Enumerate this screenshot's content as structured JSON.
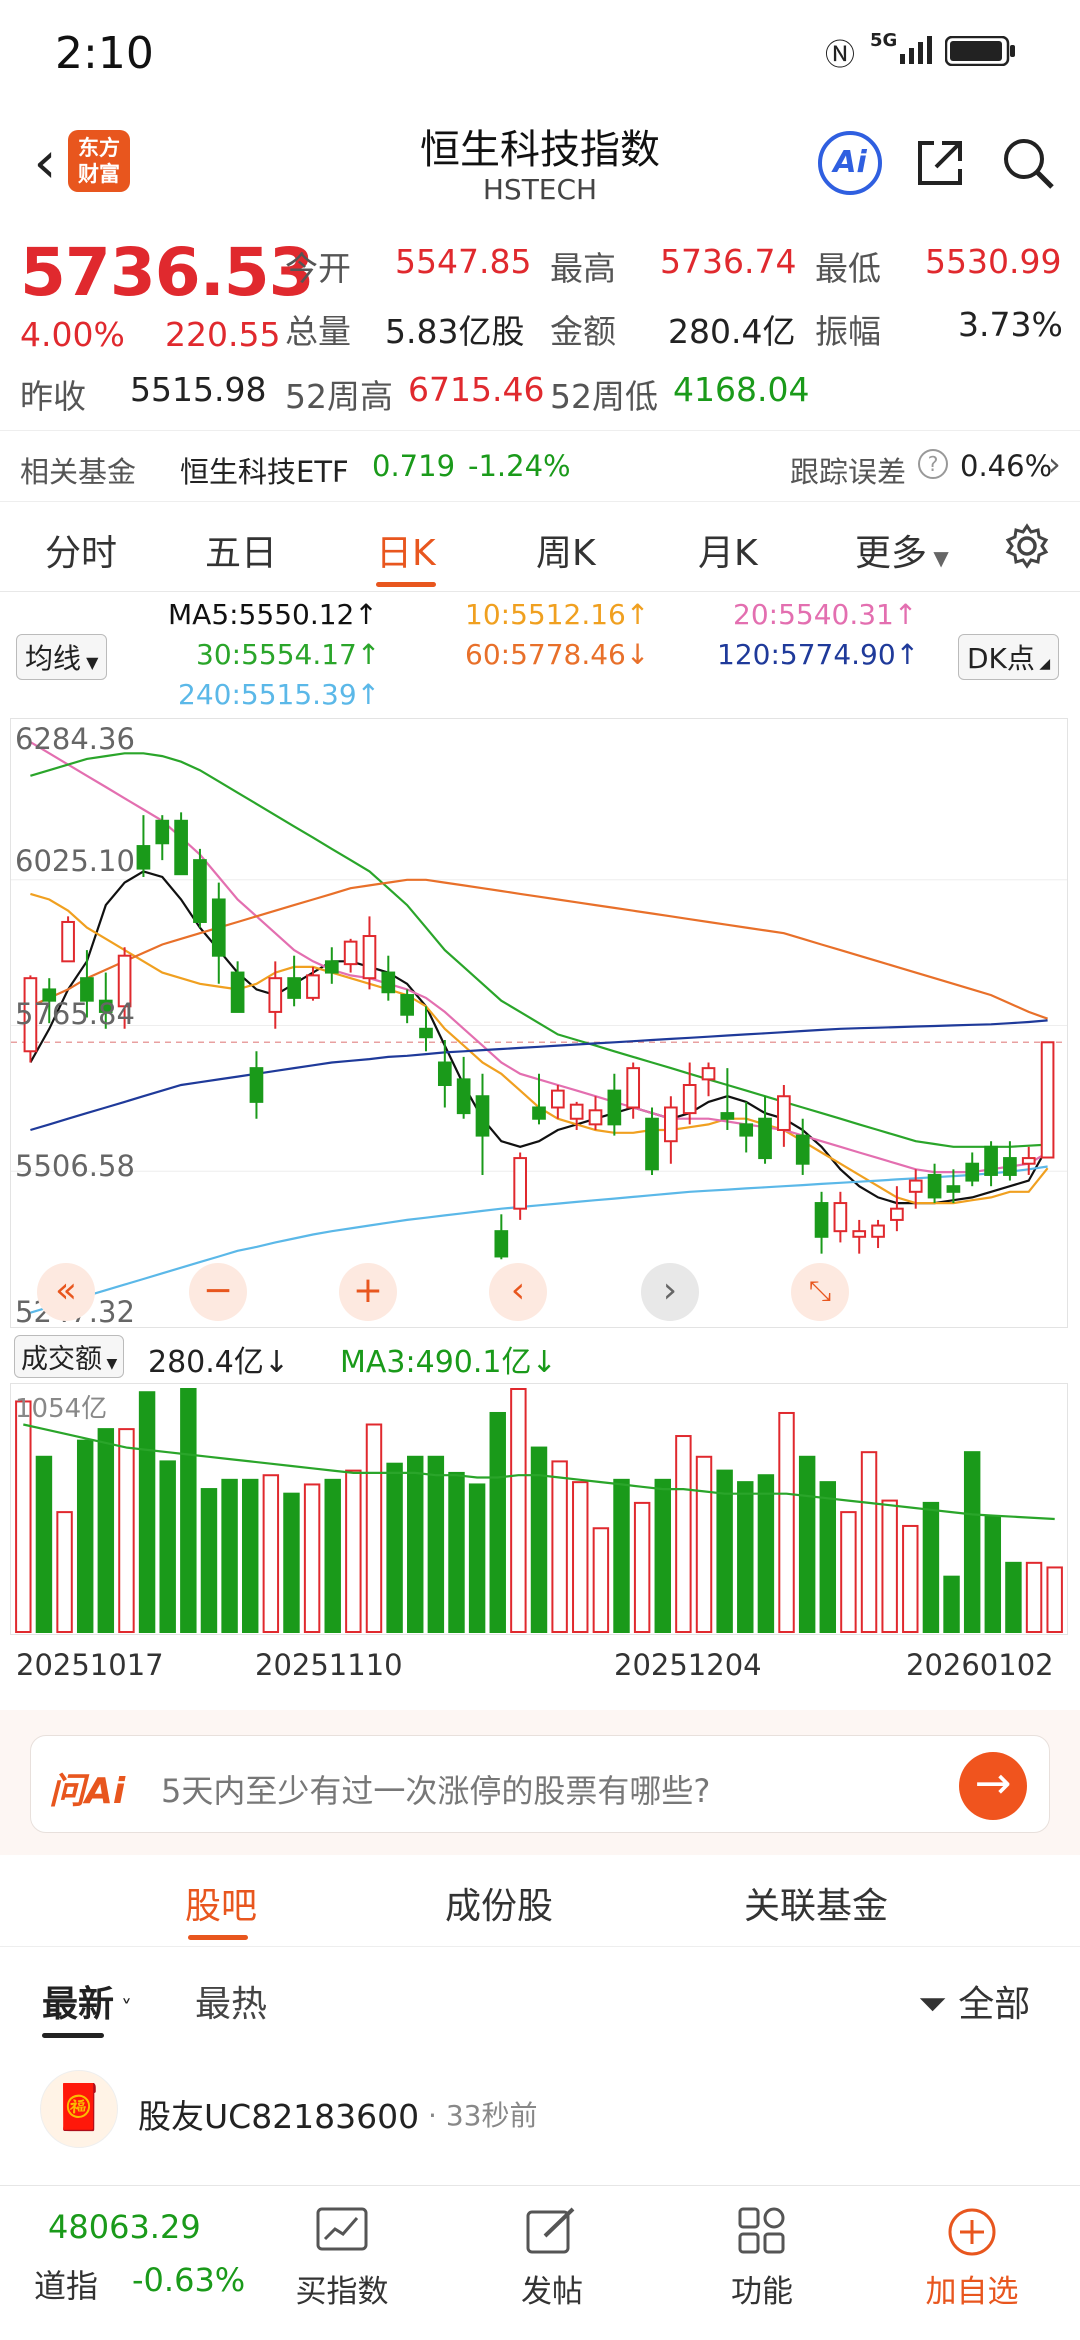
{
  "status_bar": {
    "time": "2:10",
    "network": "5G",
    "icons": [
      "nfc-icon",
      "signal-icon",
      "battery-icon"
    ]
  },
  "header": {
    "logo_text": "东方财富",
    "title": "恒生科技指数",
    "subtitle": "HSTECH",
    "ai_label": "Ai"
  },
  "quote": {
    "price": "5736.53",
    "change_pct": "4.00%",
    "change": "220.55",
    "open_label": "今开",
    "open": "5547.85",
    "high_label": "最高",
    "high": "5736.74",
    "low_label": "最低",
    "low": "5530.99",
    "volume_label": "总量",
    "volume": "5.83亿股",
    "amount_label": "金额",
    "amount": "280.4亿",
    "amplitude_label": "振幅",
    "amplitude": "3.73%",
    "prev_close_label": "昨收",
    "prev_close": "5515.98",
    "w52_high_label": "52周高",
    "w52_high": "6715.46",
    "w52_low_label": "52周低",
    "w52_low": "4168.04"
  },
  "related_fund": {
    "label": "相关基金",
    "name": "恒生科技ETF",
    "price": "0.719",
    "change": "-1.24%",
    "tracking_label": "跟踪误差",
    "tracking_value": "0.46%"
  },
  "chart_tabs": [
    "分时",
    "五日",
    "日K",
    "周K",
    "月K",
    "更多"
  ],
  "active_chart_tab": "日K",
  "ma_selector": "均线",
  "dk_button": "DK点",
  "ma_legend": {
    "ma5": "MA5:5550.12↑",
    "ma10": "10:5512.16↑",
    "ma20": "20:5540.31↑",
    "ma30": "30:5554.17↑",
    "ma60": "60:5778.46↓",
    "ma120": "120:5774.90↑",
    "ma240": "240:5515.39↑"
  },
  "colors": {
    "up": "#e0292e",
    "down": "#1a9a1a",
    "accent": "#e8561e",
    "ma5": "#111111",
    "ma10": "#f0a020",
    "ma20": "#e36fb0",
    "ma30": "#2aa52a",
    "ma60": "#e8702a",
    "ma120": "#1f3a9a",
    "ma240": "#5bb8e8"
  },
  "chart_data": {
    "type": "candlestick",
    "ylim": [
      5247.32,
      6284.36
    ],
    "y_ticks": [
      "6284.36",
      "6025.10",
      "5765.84",
      "5506.58",
      "5247.32"
    ],
    "x_ticks": [
      "20251017",
      "20251110",
      "20251204",
      "20260102"
    ],
    "candles": [
      {
        "o": 5720,
        "h": 5855,
        "l": 5700,
        "c": 5850
      },
      {
        "o": 5830,
        "h": 5850,
        "l": 5770,
        "c": 5810
      },
      {
        "o": 5880,
        "h": 5960,
        "l": 5880,
        "c": 5950
      },
      {
        "o": 5850,
        "h": 5900,
        "l": 5780,
        "c": 5810
      },
      {
        "o": 5810,
        "h": 5860,
        "l": 5760,
        "c": 5790
      },
      {
        "o": 5800,
        "h": 5905,
        "l": 5760,
        "c": 5890
      },
      {
        "o": 6085,
        "h": 6140,
        "l": 6030,
        "c": 6045
      },
      {
        "o": 6130,
        "h": 6140,
        "l": 6060,
        "c": 6090
      },
      {
        "o": 6130,
        "h": 6145,
        "l": 6035,
        "c": 6035
      },
      {
        "o": 6060,
        "h": 6080,
        "l": 5940,
        "c": 5950
      },
      {
        "o": 5990,
        "h": 6020,
        "l": 5840,
        "c": 5890
      },
      {
        "o": 5860,
        "h": 5880,
        "l": 5790,
        "c": 5790
      },
      {
        "o": 5690,
        "h": 5720,
        "l": 5600,
        "c": 5630
      },
      {
        "o": 5790,
        "h": 5880,
        "l": 5760,
        "c": 5850
      },
      {
        "o": 5850,
        "h": 5890,
        "l": 5800,
        "c": 5815
      },
      {
        "o": 5815,
        "h": 5870,
        "l": 5810,
        "c": 5855
      },
      {
        "o": 5880,
        "h": 5905,
        "l": 5840,
        "c": 5860
      },
      {
        "o": 5875,
        "h": 5920,
        "l": 5860,
        "c": 5915
      },
      {
        "o": 5850,
        "h": 5960,
        "l": 5830,
        "c": 5925
      },
      {
        "o": 5860,
        "h": 5890,
        "l": 5810,
        "c": 5825
      },
      {
        "o": 5820,
        "h": 5830,
        "l": 5770,
        "c": 5785
      },
      {
        "o": 5760,
        "h": 5800,
        "l": 5720,
        "c": 5745
      },
      {
        "o": 5700,
        "h": 5740,
        "l": 5620,
        "c": 5660
      },
      {
        "o": 5670,
        "h": 5710,
        "l": 5600,
        "c": 5610
      },
      {
        "o": 5640,
        "h": 5680,
        "l": 5500,
        "c": 5570
      },
      {
        "o": 5400,
        "h": 5430,
        "l": 5350,
        "c": 5355
      },
      {
        "o": 5440,
        "h": 5540,
        "l": 5420,
        "c": 5530
      },
      {
        "o": 5620,
        "h": 5680,
        "l": 5590,
        "c": 5600
      },
      {
        "o": 5620,
        "h": 5660,
        "l": 5600,
        "c": 5650
      },
      {
        "o": 5600,
        "h": 5630,
        "l": 5580,
        "c": 5625
      },
      {
        "o": 5590,
        "h": 5640,
        "l": 5580,
        "c": 5615
      },
      {
        "o": 5650,
        "h": 5680,
        "l": 5570,
        "c": 5590
      },
      {
        "o": 5620,
        "h": 5700,
        "l": 5600,
        "c": 5690
      },
      {
        "o": 5600,
        "h": 5620,
        "l": 5500,
        "c": 5510
      },
      {
        "o": 5560,
        "h": 5640,
        "l": 5520,
        "c": 5620
      },
      {
        "o": 5610,
        "h": 5700,
        "l": 5590,
        "c": 5660
      },
      {
        "o": 5670,
        "h": 5700,
        "l": 5640,
        "c": 5690
      },
      {
        "o": 5610,
        "h": 5690,
        "l": 5580,
        "c": 5600
      },
      {
        "o": 5590,
        "h": 5630,
        "l": 5540,
        "c": 5570
      },
      {
        "o": 5600,
        "h": 5640,
        "l": 5520,
        "c": 5530
      },
      {
        "o": 5580,
        "h": 5660,
        "l": 5550,
        "c": 5640
      },
      {
        "o": 5570,
        "h": 5600,
        "l": 5500,
        "c": 5520
      },
      {
        "o": 5450,
        "h": 5470,
        "l": 5360,
        "c": 5390
      },
      {
        "o": 5400,
        "h": 5470,
        "l": 5380,
        "c": 5450
      },
      {
        "o": 5390,
        "h": 5420,
        "l": 5360,
        "c": 5400
      },
      {
        "o": 5390,
        "h": 5420,
        "l": 5370,
        "c": 5410
      },
      {
        "o": 5420,
        "h": 5480,
        "l": 5400,
        "c": 5440
      },
      {
        "o": 5470,
        "h": 5510,
        "l": 5440,
        "c": 5490
      },
      {
        "o": 5500,
        "h": 5520,
        "l": 5450,
        "c": 5460
      },
      {
        "o": 5480,
        "h": 5510,
        "l": 5450,
        "c": 5470
      },
      {
        "o": 5520,
        "h": 5540,
        "l": 5480,
        "c": 5490
      },
      {
        "o": 5550,
        "h": 5560,
        "l": 5480,
        "c": 5500
      },
      {
        "o": 5530,
        "h": 5560,
        "l": 5490,
        "c": 5500
      },
      {
        "o": 5520,
        "h": 5550,
        "l": 5500,
        "c": 5530
      },
      {
        "o": 5531,
        "h": 5737,
        "l": 5531,
        "c": 5736
      }
    ],
    "ma_lines": {
      "ma5": [
        5700,
        5760,
        5830,
        5880,
        5980,
        6020,
        6040,
        6030,
        5990,
        5940,
        5900,
        5860,
        5830,
        5820,
        5840,
        5860,
        5880,
        5880,
        5870,
        5860,
        5840,
        5800,
        5730,
        5660,
        5600,
        5560,
        5550,
        5560,
        5580,
        5590,
        5600,
        5610,
        5620,
        5610,
        5600,
        5610,
        5630,
        5640,
        5630,
        5610,
        5600,
        5580,
        5550,
        5510,
        5480,
        5460,
        5450,
        5450,
        5450,
        5455,
        5460,
        5470,
        5480,
        5490,
        5550
      ],
      "ma10": [
        6000,
        5990,
        5970,
        5940,
        5920,
        5900,
        5880,
        5860,
        5850,
        5840,
        5835,
        5830,
        5840,
        5860,
        5870,
        5870,
        5860,
        5850,
        5840,
        5830,
        5820,
        5800,
        5760,
        5730,
        5700,
        5680,
        5650,
        5620,
        5600,
        5590,
        5580,
        5575,
        5575,
        5580,
        5580,
        5585,
        5590,
        5600,
        5600,
        5590,
        5580,
        5560,
        5540,
        5520,
        5500,
        5480,
        5460,
        5450,
        5450,
        5450,
        5455,
        5460,
        5470,
        5470,
        5512
      ],
      "ma20": [
        6270,
        6250,
        6230,
        6210,
        6190,
        6170,
        6150,
        6130,
        6100,
        6070,
        6030,
        5990,
        5960,
        5930,
        5900,
        5880,
        5865,
        5855,
        5850,
        5840,
        5830,
        5815,
        5790,
        5760,
        5730,
        5700,
        5680,
        5670,
        5660,
        5650,
        5640,
        5630,
        5620,
        5610,
        5600,
        5600,
        5600,
        5595,
        5590,
        5585,
        5580,
        5570,
        5560,
        5550,
        5540,
        5530,
        5520,
        5510,
        5505,
        5505,
        5505,
        5510,
        5515,
        5520,
        5540
      ],
      "ma30": [
        6210,
        6220,
        6230,
        6240,
        6245,
        6250,
        6250,
        6245,
        6235,
        6220,
        6200,
        6180,
        6160,
        6140,
        6120,
        6100,
        6080,
        6060,
        6040,
        6010,
        5980,
        5940,
        5900,
        5870,
        5840,
        5810,
        5790,
        5770,
        5750,
        5740,
        5730,
        5720,
        5710,
        5700,
        5690,
        5680,
        5670,
        5660,
        5650,
        5640,
        5630,
        5620,
        5610,
        5600,
        5590,
        5580,
        5570,
        5560,
        5555,
        5550,
        5550,
        5550,
        5550,
        5552,
        5554
      ],
      "ma60": [
        5800,
        5815,
        5830,
        5850,
        5865,
        5880,
        5895,
        5910,
        5920,
        5930,
        5940,
        5950,
        5960,
        5970,
        5980,
        5990,
        6000,
        6010,
        6015,
        6020,
        6025,
        6025,
        6020,
        6015,
        6010,
        6005,
        6000,
        5995,
        5990,
        5985,
        5980,
        5975,
        5970,
        5965,
        5960,
        5955,
        5950,
        5945,
        5940,
        5935,
        5930,
        5920,
        5910,
        5900,
        5890,
        5880,
        5870,
        5860,
        5850,
        5840,
        5830,
        5820,
        5805,
        5790,
        5778
      ],
      "ma120": [
        5580,
        5590,
        5600,
        5610,
        5620,
        5630,
        5640,
        5650,
        5660,
        5665,
        5670,
        5675,
        5680,
        5685,
        5690,
        5695,
        5700,
        5703,
        5706,
        5710,
        5712,
        5715,
        5718,
        5720,
        5722,
        5724,
        5726,
        5728,
        5730,
        5732,
        5734,
        5736,
        5738,
        5740,
        5742,
        5744,
        5746,
        5748,
        5750,
        5752,
        5754,
        5756,
        5758,
        5760,
        5761,
        5762,
        5763,
        5764,
        5765,
        5766,
        5767,
        5768,
        5770,
        5772,
        5775
      ],
      "ma240": [
        5255,
        5265,
        5275,
        5285,
        5295,
        5305,
        5315,
        5325,
        5335,
        5345,
        5355,
        5365,
        5372,
        5380,
        5387,
        5394,
        5400,
        5405,
        5410,
        5415,
        5420,
        5424,
        5428,
        5432,
        5436,
        5440,
        5443,
        5446,
        5449,
        5452,
        5455,
        5458,
        5461,
        5464,
        5467,
        5470,
        5472,
        5474,
        5476,
        5478,
        5480,
        5482,
        5484,
        5486,
        5488,
        5490,
        5492,
        5494,
        5496,
        5498,
        5500,
        5503,
        5506,
        5510,
        5515
      ]
    },
    "volume": {
      "label": "成交额",
      "value": "280.4亿",
      "ma3_label": "MA3:490.1亿",
      "max_label": "1054亿",
      "bars": [
        1000,
        760,
        520,
        830,
        880,
        880,
        1040,
        740,
        1054,
        620,
        660,
        660,
        680,
        600,
        640,
        660,
        700,
        900,
        730,
        760,
        760,
        690,
        640,
        950,
        1054,
        800,
        740,
        650,
        450,
        660,
        560,
        660,
        850,
        760,
        700,
        650,
        680,
        950,
        760,
        650,
        520,
        780,
        570,
        460,
        560,
        240,
        780,
        500,
        300,
        300,
        280
      ],
      "ma3": [
        900,
        880,
        860,
        840,
        820,
        800,
        790,
        780,
        770,
        760,
        750,
        740,
        730,
        720,
        710,
        700,
        690,
        690,
        690,
        690,
        680,
        680,
        670,
        670,
        680,
        680,
        670,
        660,
        650,
        640,
        630,
        620,
        620,
        610,
        600,
        600,
        600,
        600,
        590,
        580,
        570,
        560,
        550,
        540,
        530,
        520,
        510,
        505,
        500,
        495,
        490
      ]
    }
  },
  "chart_controls": [
    "rewind-icon",
    "zoom-out-icon",
    "zoom-in-icon",
    "prev-icon",
    "next-icon",
    "fullscreen-icon"
  ],
  "ai_bar": {
    "logo": "问Ai",
    "placeholder": "5天内至少有过一次涨停的股票有哪些?"
  },
  "lower_tabs": [
    "股吧",
    "成份股",
    "关联基金"
  ],
  "active_lower_tab": "股吧",
  "sort_tabs": {
    "latest": "最新",
    "hot": "最热",
    "filter": "全部"
  },
  "post": {
    "author": "股友UC82183600",
    "time": "33秒前"
  },
  "bottom_nav": {
    "index_value": "48063.29",
    "index_name": "道指",
    "index_change": "-0.63%",
    "items": [
      {
        "label": "买指数",
        "icon": "chart-icon"
      },
      {
        "label": "发帖",
        "icon": "edit-icon"
      },
      {
        "label": "功能",
        "icon": "grid-icon"
      },
      {
        "label": "加自选",
        "icon": "add-circle-icon"
      }
    ]
  }
}
